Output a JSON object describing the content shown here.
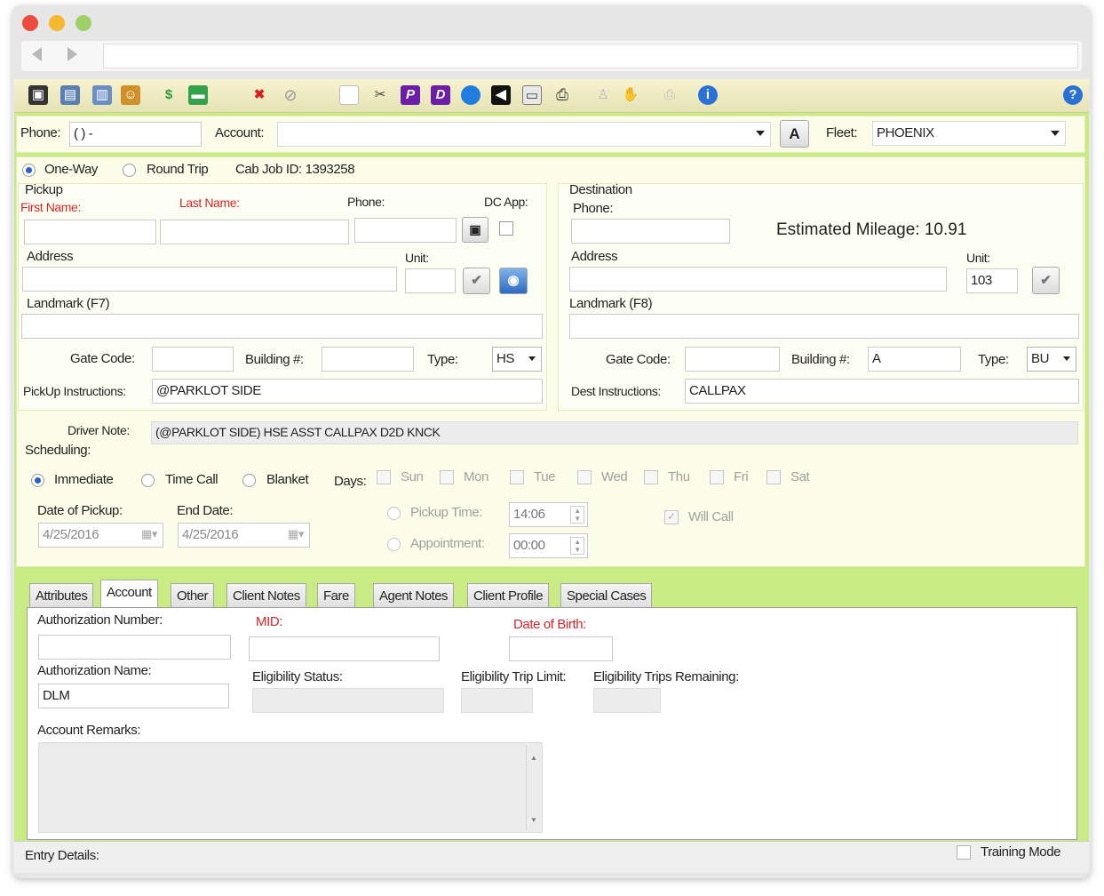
{
  "toolbar": {
    "icons": [
      "binoculars-icon",
      "document-search-icon",
      "window-icon",
      "user-icon",
      "dollar-icon",
      "car-icon",
      "delete-icon",
      "cancel-icon",
      "blank-document-icon",
      "tools-icon",
      "p-icon",
      "d-icon",
      "globe-icon",
      "back-arrow-icon",
      "card-icon",
      "printer-icon",
      "person-disabled-icon",
      "hand-disabled-icon",
      "print-disabled-icon",
      "info-icon",
      "help-icon"
    ]
  },
  "header": {
    "phone_label": "Phone:",
    "phone_value": "( )  -",
    "account_label": "Account:",
    "account_value": "",
    "a_button": "A",
    "fleet_label": "Fleet:",
    "fleet_value": "PHOENIX"
  },
  "trip": {
    "one_way": "One-Way",
    "round_trip": "Round Trip",
    "cab_job": "Cab Job ID: 1393258"
  },
  "pickup": {
    "title": "Pickup",
    "first_name": "First Name:",
    "last_name": "Last Name:",
    "phone": "Phone:",
    "dc_app": "DC App:",
    "address": "Address",
    "unit": "Unit:",
    "landmark": "Landmark (F7)",
    "gate_code": "Gate Code:",
    "building": "Building #:",
    "type_label": "Type:",
    "type_value": "HS",
    "instructions_label": "PickUp Instructions:",
    "instructions_value": "@PARKLOT SIDE"
  },
  "destination": {
    "title": "Destination",
    "phone": "Phone:",
    "mileage": "Estimated Mileage: 10.91",
    "address": "Address",
    "unit": "Unit:",
    "unit_value": "103",
    "landmark": "Landmark (F8)",
    "gate_code": "Gate Code:",
    "building": "Building #:",
    "building_value": "A",
    "type_label": "Type:",
    "type_value": "BU",
    "instructions_label": "Dest Instructions:",
    "instructions_value": "CALLPAX"
  },
  "driver_note": {
    "label": "Driver Note:",
    "value": "(@PARKLOT SIDE) HSE ASST CALLPAX D2D KNCK"
  },
  "scheduling": {
    "title": "Scheduling:",
    "immediate": "Immediate",
    "time_call": "Time Call",
    "blanket": "Blanket",
    "days_label": "Days:",
    "days": [
      "Sun",
      "Mon",
      "Tue",
      "Wed",
      "Thu",
      "Fri",
      "Sat"
    ],
    "date_pickup_label": "Date of Pickup:",
    "date_pickup": "4/25/2016",
    "end_date_label": "End Date:",
    "end_date": "4/25/2016",
    "pickup_time_label": "Pickup Time:",
    "pickup_time": "14:06",
    "appointment_label": "Appointment:",
    "appointment_time": "00:00",
    "will_call": "Will Call"
  },
  "tabs": [
    "Attributes",
    "Account",
    "Other",
    "Client Notes",
    "Fare",
    "Agent Notes",
    "Client Profile",
    "Special Cases"
  ],
  "account_tab": {
    "auth_number": "Authorization Number:",
    "mid": "MID:",
    "dob": "Date of Birth:",
    "auth_name": "Authorization Name:",
    "auth_name_value": "DLM",
    "elig_status": "Eligibility Status:",
    "elig_trip_limit": "Eligibility Trip Limit:",
    "elig_trips_remaining": "Eligibility Trips Remaining:",
    "remarks": "Account Remarks:"
  },
  "status": {
    "entry_details": "Entry Details:",
    "training_mode": "Training Mode"
  }
}
